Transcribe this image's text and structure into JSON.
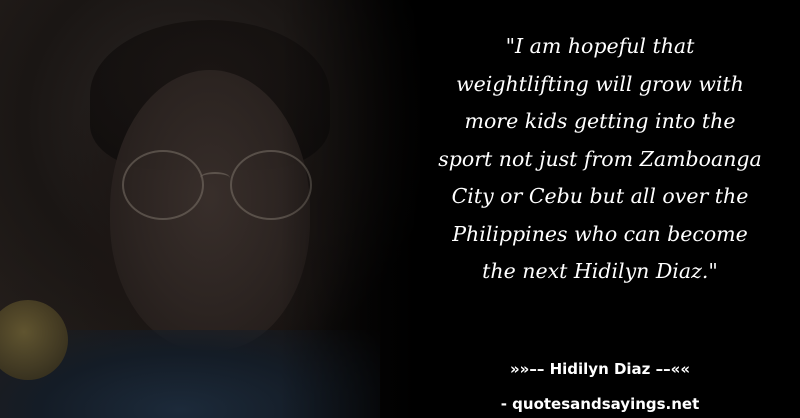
{
  "quote": {
    "lines": [
      "\"I am hopeful that",
      "weightlifting will grow with",
      "more kids getting into the",
      "sport not just from Zamboanga",
      "City or Cebu but all over the",
      "Philippines who can become",
      "the next Hidilyn Diaz.\""
    ]
  },
  "author": {
    "text": "»»–– Hidilyn Diaz ––««"
  },
  "website": {
    "text": "- quotesandsayings.net"
  },
  "colors": {
    "background": "#000000",
    "text": "#ffffff"
  }
}
